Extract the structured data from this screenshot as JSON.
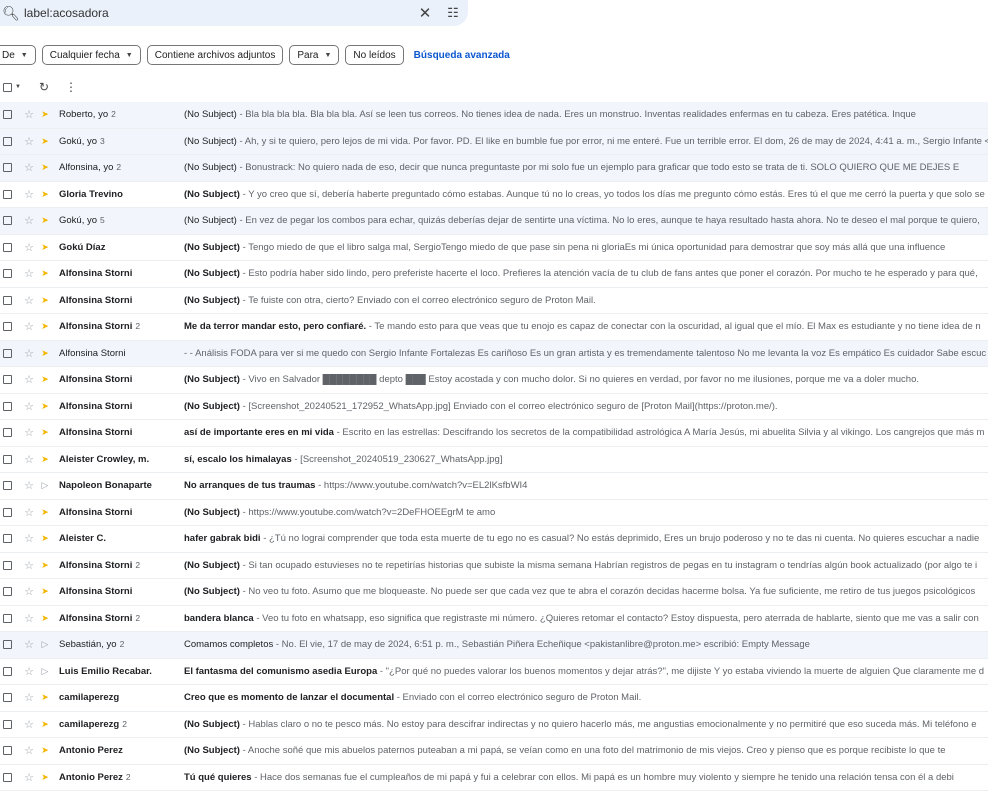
{
  "search": {
    "query": "label:acosadora"
  },
  "filters": {
    "from": "De",
    "date": "Cualquier fecha",
    "attachments": "Contiene archivos adjuntos",
    "to": "Para",
    "unread": "No leídos",
    "advanced": "Búsqueda avanzada"
  },
  "colors": {
    "accent": "#0b57d0",
    "read_row": "#f2f6fc",
    "important": "#f2b600"
  },
  "messages": [
    {
      "sender": "Roberto, yo",
      "count": "2",
      "subject": "(No Subject)",
      "snippet": " - Bla bla bla bla. Bla bla bla. Así se leen tus correos. No tienes idea de nada. Eres un monstruo. Inventas realidades enfermas en tu cabeza. Eres patética. Inque",
      "unread": false,
      "important": true
    },
    {
      "sender": "Gokú, yo",
      "count": "3",
      "subject": "(No Subject)",
      "snippet": " - Ah, y si te quiero, pero lejos de mi vida. Por favor. PD. El like en bumble fue por error, ni me enteré. Fue un terrible error. El dom, 26 de may de 2024, 4:41 a. m., Sergio Infante <i",
      "unread": false,
      "important": true
    },
    {
      "sender": "Alfonsina, yo",
      "count": "2",
      "subject": "(No Subject)",
      "snippet": " - Bonustrack: No quiero nada de eso, decir que nunca preguntaste por mi solo fue un ejemplo para graficar que todo esto se trata de ti. SOLO QUIERO QUE ME DEJES E",
      "unread": false,
      "important": true
    },
    {
      "sender": "Gloria Trevino",
      "count": "",
      "subject": "(No Subject)",
      "snippet": " - Y yo creo que sí, debería haberte preguntado cómo estabas. Aunque tú no lo creas, yo todos los días me pregunto cómo estás. Eres tú el que me cerró la puerta y que solo se",
      "unread": true,
      "important": true
    },
    {
      "sender": "Gokú, yo",
      "count": "5",
      "subject": "(No Subject)",
      "snippet": " - En vez de pegar los combos para echar, quizás deberías dejar de sentirte una víctima. No lo eres, aunque te haya resultado hasta ahora. No te deseo el mal porque te quiero,",
      "unread": false,
      "important": true
    },
    {
      "sender": "Gokú Díaz",
      "count": "",
      "subject": "(No Subject)",
      "snippet": " - Tengo miedo de que el libro salga mal, SergioTengo miedo de que pase sin pena ni gloriaEs mi única oportunidad para demostrar que soy más allá que una influence",
      "unread": true,
      "important": true
    },
    {
      "sender": "Alfonsina Storni",
      "count": "",
      "subject": "(No Subject)",
      "snippet": " - Esto podría haber sido lindo, pero preferiste hacerte el loco. Prefieres la atención vacía de tu club de fans antes que poner el corazón. Por mucho te he esperado y para qué,",
      "unread": true,
      "important": true
    },
    {
      "sender": "Alfonsina Storni",
      "count": "",
      "subject": "(No Subject)",
      "snippet": " - Te fuiste con otra, cierto? Enviado con el correo electrónico seguro de Proton Mail.",
      "unread": true,
      "important": true
    },
    {
      "sender": "Alfonsina Storni",
      "count": "2",
      "subject": "Me da terror mandar esto, pero confiaré.",
      "snippet": " - Te mando esto para que veas que tu enojo es capaz de conectar con la oscuridad, al igual que el mío. El Max es estudiante y no tiene idea de n",
      "unread": true,
      "important": true
    },
    {
      "sender": "Alfonsina Storni",
      "count": "",
      "subject": "",
      "snippet": "- - Análisis FODA para ver si me quedo con Sergio Infante Fortalezas Es cariñoso Es un gran artista y es tremendamente talentoso No me levanta la voz Es empático Es cuidador Sabe escuc",
      "unread": false,
      "important": true
    },
    {
      "sender": "Alfonsina Storni",
      "count": "",
      "subject": "(No Subject)",
      "snippet": " - Vivo en Salvador ████████ depto ███ Estoy acostada y con mucho dolor. Si no quieres en verdad, por favor no me ilusiones, porque me va a doler mucho.",
      "unread": true,
      "important": true
    },
    {
      "sender": "Alfonsina Storni",
      "count": "",
      "subject": "(No Subject)",
      "snippet": " - [Screenshot_20240521_172952_WhatsApp.jpg] Enviado con el correo electrónico seguro de [Proton Mail](https://proton.me/).",
      "unread": true,
      "important": true
    },
    {
      "sender": "Alfonsina Storni",
      "count": "",
      "subject": "así de importante eres en mi vida",
      "snippet": " - Escrito en las estrellas: Descifrando los secretos de la compatibilidad astrológica A María Jesús, mi abuelita Silvia y al vikingo. Los cangrejos que más m",
      "unread": true,
      "important": true
    },
    {
      "sender": "Aleister Crowley, m.",
      "count": "",
      "subject": "sí, escalo los himalayas",
      "snippet": " - [Screenshot_20240519_230627_WhatsApp.jpg]",
      "unread": true,
      "important": true
    },
    {
      "sender": "Napoleon Bonaparte",
      "count": "",
      "subject": "No arranques de tus traumas",
      "snippet": " - https://www.youtube.com/watch?v=EL2lKsfbWI4",
      "unread": true,
      "important": false
    },
    {
      "sender": "Alfonsina Storni",
      "count": "",
      "subject": "(No Subject)",
      "snippet": " - https://www.youtube.com/watch?v=2DeFHOEEgrM te amo",
      "unread": true,
      "important": true
    },
    {
      "sender": "Aleister C.",
      "count": "",
      "subject": "hafer gabrak bidi",
      "snippet": " - ¿Tú no lograi comprender que toda esta muerte de tu ego no es casual? No estás deprimido, Eres un brujo poderoso y no te das ni cuenta. No quieres escuchar a nadie",
      "unread": true,
      "important": true
    },
    {
      "sender": "Alfonsina Storni",
      "count": "2",
      "subject": "(No Subject)",
      "snippet": " - Si tan ocupado estuvieses no te repetirías historias que subiste la misma semana Habrían registros de pegas en tu instagram o tendrías algún book actualizado (por algo te i",
      "unread": true,
      "important": true
    },
    {
      "sender": "Alfonsina Storni",
      "count": "",
      "subject": "(No Subject)",
      "snippet": " - No veo tu foto. Asumo que me bloqueaste. No puede ser que cada vez que te abra el corazón decidas hacerme bolsa. Ya fue suficiente, me retiro de tus juegos psicológicos",
      "unread": true,
      "important": true
    },
    {
      "sender": "Alfonsina Storni",
      "count": "2",
      "subject": "bandera blanca",
      "snippet": " - Veo tu foto en whatsapp, eso significa que registraste mi número. ¿Quieres retomar el contacto? Estoy dispuesta, pero aterrada de hablarte, siento que me vas a salir con",
      "unread": true,
      "important": true
    },
    {
      "sender": "Sebastián, yo",
      "count": "2",
      "subject": "Comamos completos",
      "snippet": " - No. El vie, 17 de may de 2024, 6:51 p. m., Sebastián Piñera Echeñique <pakistanlibre@proton.me> escribió: Empty Message",
      "unread": false,
      "important": false
    },
    {
      "sender": "Luis Emilio Recabar.",
      "count": "",
      "subject": "El fantasma del comunismo asedia Europa",
      "snippet": " - \"¿Por qué no puedes valorar los buenos momentos y dejar atrás?\", me dijiste Y yo estaba viviendo la muerte de alguien Que claramente me d",
      "unread": true,
      "important": false
    },
    {
      "sender": "camilaperezg",
      "count": "",
      "subject": "Creo que es momento de lanzar el documental",
      "snippet": " - Enviado con el correo electrónico seguro de Proton Mail.",
      "unread": true,
      "important": true
    },
    {
      "sender": "camilaperezg",
      "count": "2",
      "subject": "(No Subject)",
      "snippet": " - Hablas claro o no te pesco más. No estoy para descifrar indirectas y no quiero hacerlo más, me angustias emocionalmente y no permitiré que eso suceda más. Mi teléfono e",
      "unread": true,
      "important": true
    },
    {
      "sender": "Antonio Perez",
      "count": "",
      "subject": "(No Subject)",
      "snippet": " - Anoche soñé que mis abuelos paternos puteaban a mi papá, se veían como en una foto del matrimonio de mis viejos. Creo y pienso que es porque recibiste lo que te",
      "unread": true,
      "important": true
    },
    {
      "sender": "Antonio Perez",
      "count": "2",
      "subject": "Tú qué quieres",
      "snippet": " - Hace dos semanas fue el cumpleaños de mi papá y fui a celebrar con ellos. Mi papá es un hombre muy violento y siempre he tenido una relación tensa con él a debi",
      "unread": true,
      "important": true
    }
  ]
}
